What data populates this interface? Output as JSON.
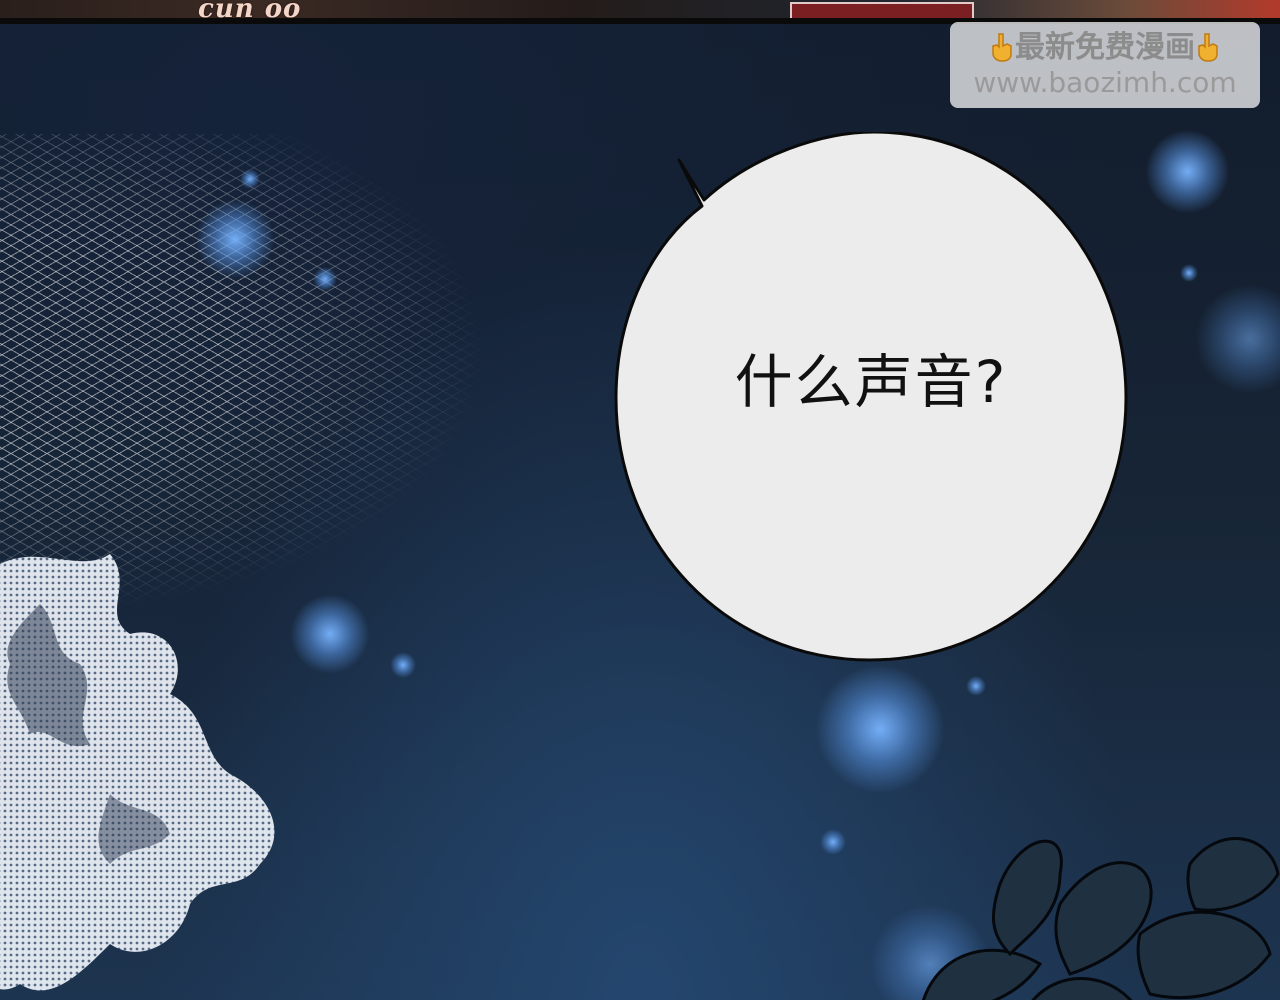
{
  "speech_bubble": {
    "text": "什么声音?"
  },
  "watermark": {
    "line1": "最新免费漫画",
    "line2": "www.baozimh.com",
    "icon": "pointing-down-hand-icon"
  },
  "top_strip": {
    "scribble": "cun oo"
  },
  "colors": {
    "background": "#121c2c",
    "orb": "#78b4ff",
    "bubble_fill": "#ececec",
    "bubble_stroke": "#0a0a0a"
  }
}
